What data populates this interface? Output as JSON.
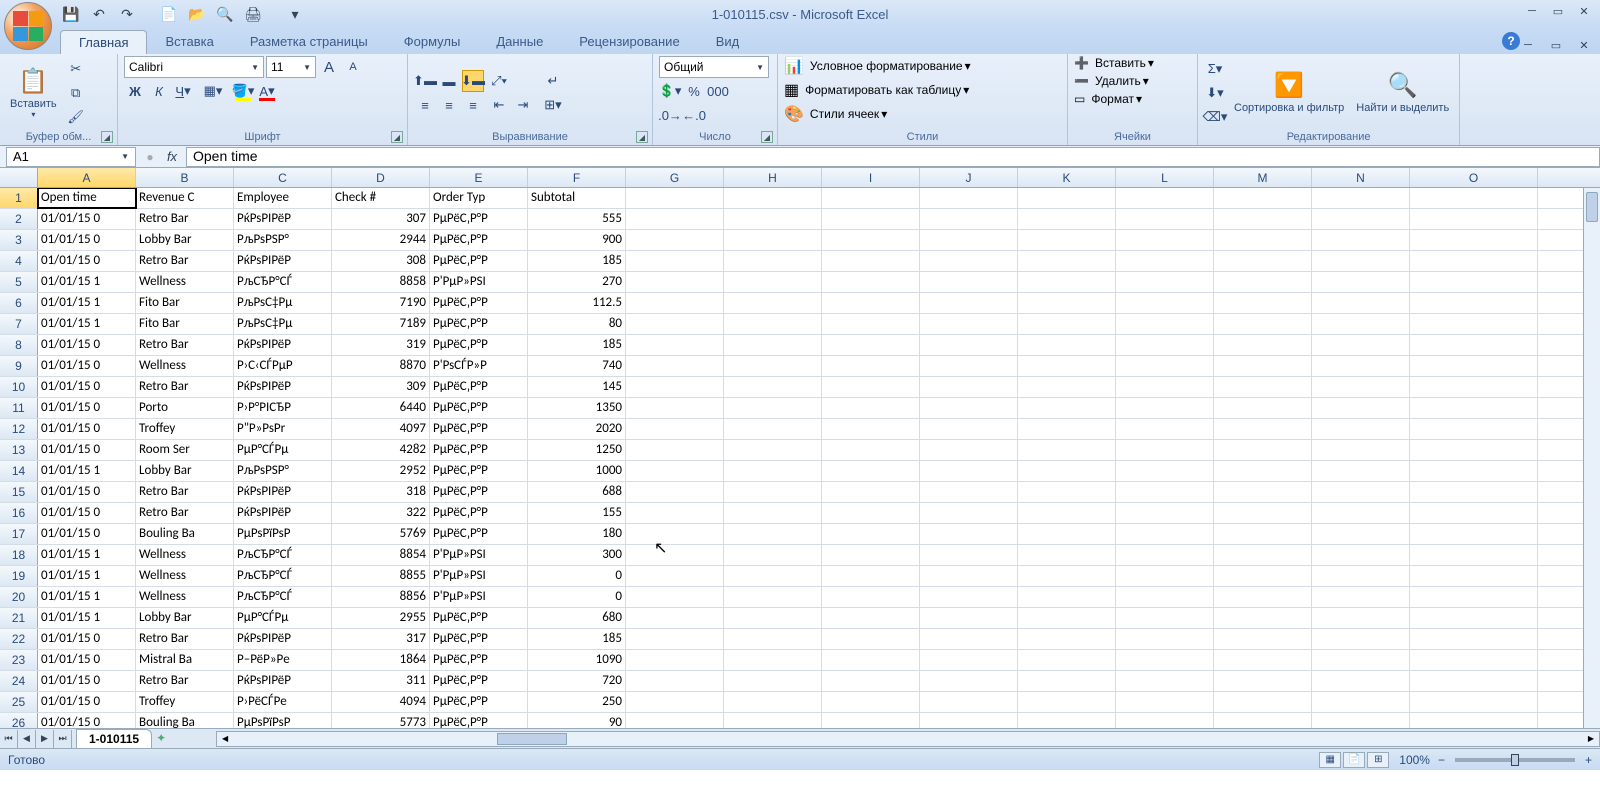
{
  "title": "1-010115.csv - Microsoft Excel",
  "qat": {
    "save": "💾",
    "undo": "↶",
    "redo": "↷",
    "new": "📄",
    "open": "📂",
    "preview": "🔍",
    "print": "🖨",
    "more": "▾"
  },
  "tabs": [
    "Главная",
    "Вставка",
    "Разметка страницы",
    "Формулы",
    "Данные",
    "Рецензирование",
    "Вид"
  ],
  "activeTab": 0,
  "ribbon": {
    "clipboard": {
      "label": "Буфер обм...",
      "paste": "Вставить"
    },
    "font": {
      "label": "Шрифт",
      "name": "Calibri",
      "size": "11"
    },
    "alignment": {
      "label": "Выравнивание"
    },
    "number": {
      "label": "Число",
      "format": "Общий"
    },
    "styles": {
      "label": "Стили",
      "cond": "Условное форматирование",
      "table": "Форматировать как таблицу",
      "cell": "Стили ячеек"
    },
    "cells": {
      "label": "Ячейки",
      "insert": "Вставить",
      "delete": "Удалить",
      "format": "Формат"
    },
    "editing": {
      "label": "Редактирование",
      "sort": "Сортировка и фильтр",
      "find": "Найти и выделить"
    }
  },
  "namebox": "A1",
  "formula": "Open time",
  "columns": [
    "A",
    "B",
    "C",
    "D",
    "E",
    "F",
    "G",
    "H",
    "I",
    "J",
    "K",
    "L",
    "M",
    "N",
    "O"
  ],
  "headers": [
    "Open time",
    "Revenue C",
    "Employee",
    "Check #",
    "Order Typ",
    "Subtotal"
  ],
  "rows": [
    [
      "01/01/15 0",
      "Retro Bar",
      "PќPsPIPëP",
      "307",
      "PµPëC‚P°P",
      "555"
    ],
    [
      "01/01/15 0",
      "Lobby Bar",
      "PљPsPSP°",
      "2944",
      "PµPëC‚P°P",
      "900"
    ],
    [
      "01/01/15 0",
      "Retro Bar",
      "PќPsPIPëP",
      "308",
      "PµPëC‚P°P",
      "185"
    ],
    [
      "01/01/15 1",
      "Wellness",
      "PљCЂP°CЃ",
      "8858",
      "P'PµP»PSI",
      "270"
    ],
    [
      "01/01/15 1",
      "Fito Bar",
      "PљPsC‡Pµ",
      "7190",
      "PµPëC‚P°P",
      "112.5"
    ],
    [
      "01/01/15 1",
      "Fito Bar",
      "PљPsC‡Pµ",
      "7189",
      "PµPëC‚P°P",
      "80"
    ],
    [
      "01/01/15 0",
      "Retro Bar",
      "PќPsPIPëP",
      "319",
      "PµPëC‚P°P",
      "185"
    ],
    [
      "01/01/15 0",
      "Wellness",
      "P›C‹CЃPµP",
      "8870",
      "P'PsCЃP»P",
      "740"
    ],
    [
      "01/01/15 0",
      "Retro Bar",
      "PќPsPIPëP",
      "309",
      "PµPëC‚P°P",
      "145"
    ],
    [
      "01/01/15 0",
      "Porto",
      "P›P°PICЂP",
      "6440",
      "PµPëC‚P°P",
      "1350"
    ],
    [
      "01/01/15 0",
      "Troffey",
      "P\"P»PsPr",
      "4097",
      "PµPëC‚P°P",
      "2020"
    ],
    [
      "01/01/15 0",
      "Room Ser",
      "PµP°CЃPµ",
      "4282",
      "PµPëC‚P°P",
      "1250"
    ],
    [
      "01/01/15 1",
      "Lobby Bar",
      "PљPsPSP°",
      "2952",
      "PµPëC‚P°P",
      "1000"
    ],
    [
      "01/01/15 0",
      "Retro Bar",
      "PќPsPIPëP",
      "318",
      "PµPëC‚P°P",
      "688"
    ],
    [
      "01/01/15 0",
      "Retro Bar",
      "PќPsPIPëP",
      "322",
      "PµPëC‚P°P",
      "155"
    ],
    [
      "01/01/15 0",
      "Bouling Ba",
      "PµPsPïPsP",
      "5769",
      "PµPëC‚P°P",
      "180"
    ],
    [
      "01/01/15 1",
      "Wellness",
      "PљCЂP°CЃ",
      "8854",
      "P'PµP»PSI",
      "300"
    ],
    [
      "01/01/15 1",
      "Wellness",
      "PљCЂP°CЃ",
      "8855",
      "P'PµP»PSI",
      "0"
    ],
    [
      "01/01/15 1",
      "Wellness",
      "PљCЂP°CЃ",
      "8856",
      "P'PµP»PSI",
      "0"
    ],
    [
      "01/01/15 1",
      "Lobby Bar",
      "PµP°CЃPµ",
      "2955",
      "PµPëC‚P°P",
      "680"
    ],
    [
      "01/01/15 0",
      "Retro Bar",
      "PќPsPIPëP",
      "317",
      "PµPëC‚P°P",
      "185"
    ],
    [
      "01/01/15 0",
      "Mistral Ba",
      "P–PëP»Pе",
      "1864",
      "PµPëC‚P°P",
      "1090"
    ],
    [
      "01/01/15 0",
      "Retro Bar",
      "PќPsPIPëP",
      "311",
      "PµPëC‚P°P",
      "720"
    ],
    [
      "01/01/15 0",
      "Troffey",
      "P›PëCЃPе",
      "4094",
      "PµPëC‚P°P",
      "250"
    ],
    [
      "01/01/15 0",
      "Bouling Ba",
      "PµPsPïPsP",
      "5773",
      "PµPëC‚P°P",
      "90"
    ]
  ],
  "sheet": "1-010115",
  "status": "Готово",
  "zoom": "100%"
}
